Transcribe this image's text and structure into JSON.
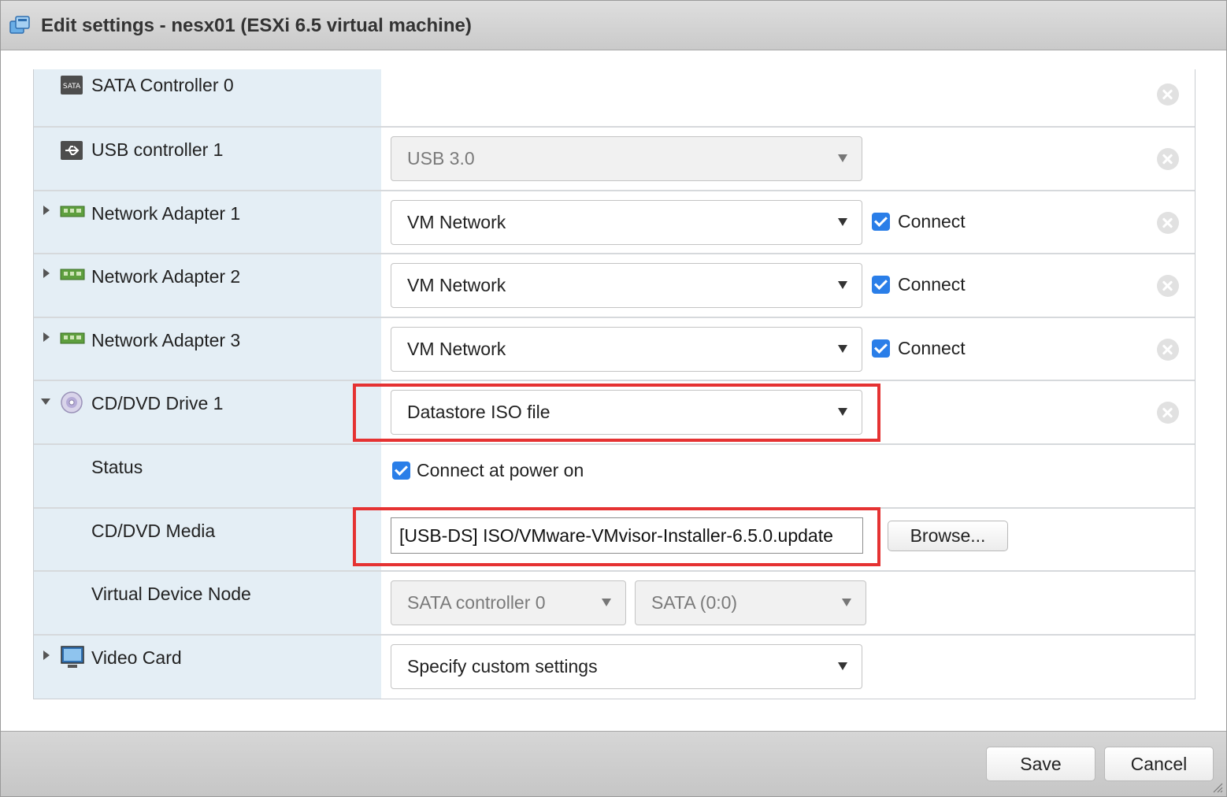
{
  "window": {
    "title": "Edit settings - nesx01 (ESXi 6.5 virtual machine)",
    "icon": "vm-settings-icon"
  },
  "devices": {
    "sata_controller": {
      "label": "SATA Controller 0",
      "icon_text": "SATA"
    },
    "usb_controller": {
      "label": "USB controller 1",
      "value": "USB 3.0"
    },
    "net1": {
      "label": "Network Adapter 1",
      "value": "VM Network",
      "connect_label": "Connect",
      "connected": true
    },
    "net2": {
      "label": "Network Adapter 2",
      "value": "VM Network",
      "connect_label": "Connect",
      "connected": true
    },
    "net3": {
      "label": "Network Adapter 3",
      "value": "VM Network",
      "connect_label": "Connect",
      "connected": true
    },
    "cdrom": {
      "label": "CD/DVD Drive 1",
      "value": "Datastore ISO file",
      "status_label": "Status",
      "status_value": "Connect at power on",
      "media_label": "CD/DVD Media",
      "media_value": "[USB-DS] ISO/VMware-VMvisor-Installer-6.5.0.update",
      "browse_label": "Browse...",
      "node_label": "Virtual Device Node",
      "node_controller": "SATA controller 0",
      "node_port": "SATA (0:0)"
    },
    "video": {
      "label": "Video Card",
      "value": "Specify custom settings"
    }
  },
  "footer": {
    "save_label": "Save",
    "cancel_label": "Cancel"
  },
  "colors": {
    "accent": "#2a7ee8",
    "highlight": "#e53232",
    "label_bg": "#e4eef5"
  }
}
